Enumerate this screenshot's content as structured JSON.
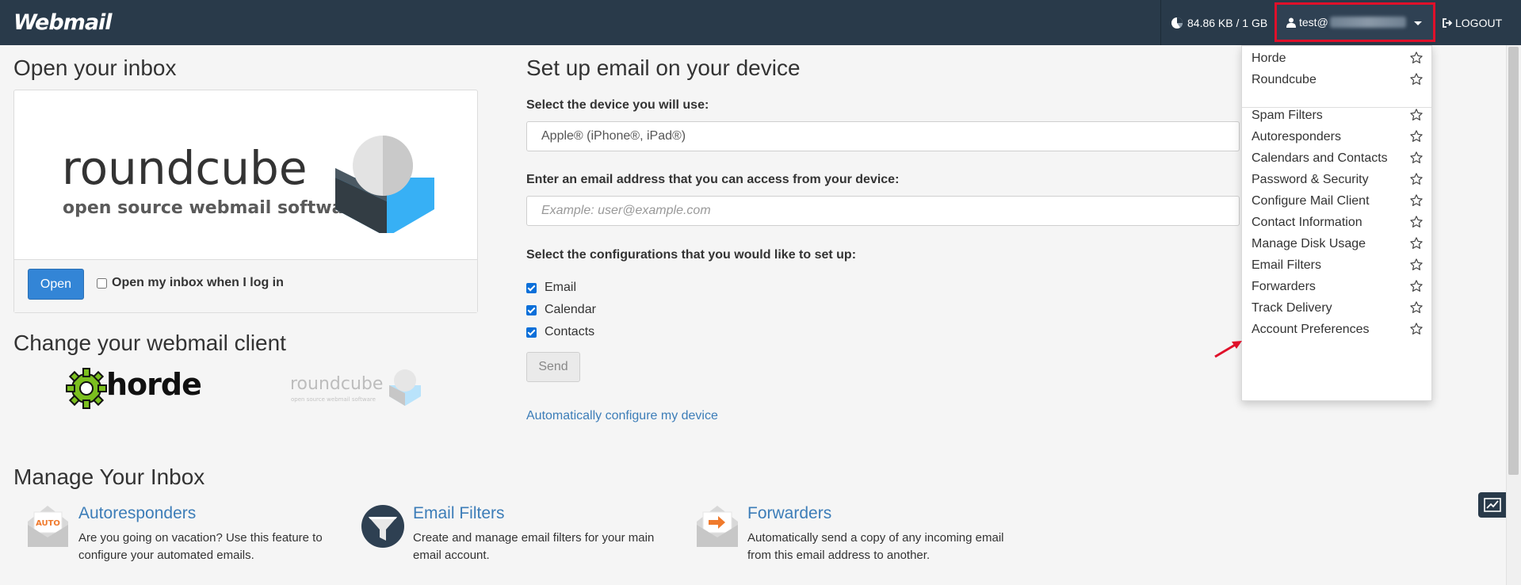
{
  "header": {
    "logo": "Webmail",
    "disk_usage": "84.86 KB / 1 GB",
    "user_prefix": "test@",
    "logout": "LOGOUT"
  },
  "inbox": {
    "title": "Open your inbox",
    "logo_word": "roundcube",
    "logo_tagline": "open source webmail software",
    "open_button": "Open",
    "open_on_login_label": "Open my inbox when I log in"
  },
  "clients": {
    "title": "Change your webmail client",
    "horde": "horde",
    "roundcube": "roundcube",
    "roundcube_tagline": "open source webmail software"
  },
  "setup": {
    "title": "Set up email on your device",
    "device_label": "Select the device you will use:",
    "device_value": "Apple® (iPhone®, iPad®)",
    "email_label": "Enter an email address that you can access from your device:",
    "email_placeholder": "Example: user@example.com",
    "config_label": "Select the configurations that you would like to set up:",
    "configs": [
      "Email",
      "Calendar",
      "Contacts"
    ],
    "send_button": "Send",
    "auto_link": "Automatically configure my device"
  },
  "dropdown": {
    "items": [
      "Horde",
      "Roundcube",
      "Spam Filters",
      "Autoresponders",
      "Calendars and Contacts",
      "Password & Security",
      "Configure Mail Client",
      "Contact Information",
      "Manage Disk Usage",
      "Email Filters",
      "Forwarders",
      "Track Delivery",
      "Account Preferences"
    ]
  },
  "manage": {
    "title": "Manage Your Inbox",
    "items": [
      {
        "title": "Autoresponders",
        "desc": "Are you going on vacation? Use this feature to configure your automated emails.",
        "badge": "AUTO"
      },
      {
        "title": "Email Filters",
        "desc": "Create and manage email filters for your main email account."
      },
      {
        "title": "Forwarders",
        "desc": "Automatically send a copy of any incoming email from this email address to another."
      }
    ]
  },
  "colors": {
    "topbar": "#293a4a",
    "accent": "#3385d6",
    "link": "#3c7db8",
    "highlight": "#e0102a"
  }
}
